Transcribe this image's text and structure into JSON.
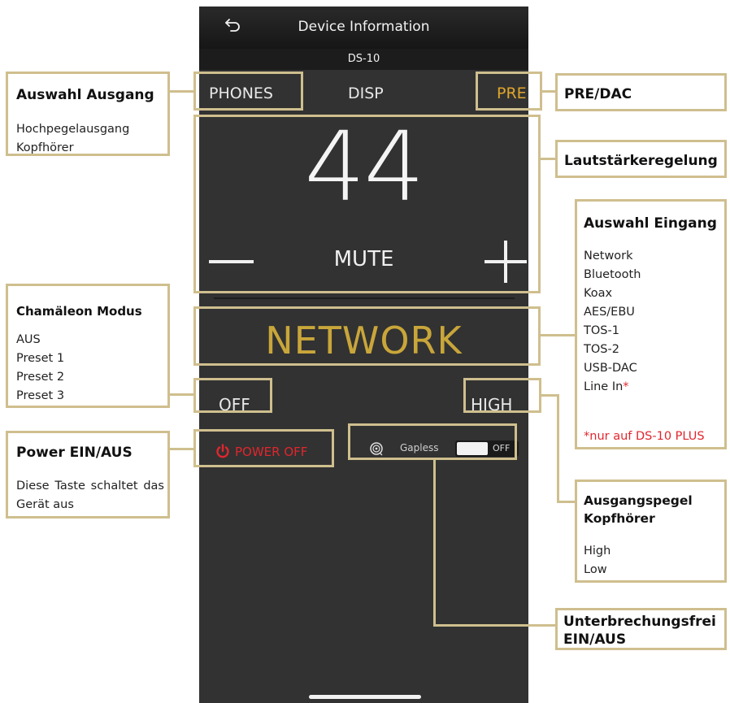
{
  "app": {
    "title": "Device Information",
    "model": "DS-10",
    "back_icon": "back-arrow-icon"
  },
  "output_tabs": [
    "PHONES",
    "DISP",
    "PRE"
  ],
  "volume": {
    "value": "44",
    "mute_label": "MUTE",
    "minus_icon": "minus-icon",
    "plus_icon": "plus-icon"
  },
  "input": {
    "current": "NETWORK"
  },
  "chameleon_mode": {
    "value": "OFF"
  },
  "headphone_level": {
    "value": "HIGH"
  },
  "power": {
    "label": "POWER OFF",
    "icon": "power-icon",
    "color": "#e0262d"
  },
  "gapless": {
    "label": "Gapless",
    "switch_state": "OFF",
    "icon": "disc-icon"
  },
  "callouts": {
    "output_select": {
      "title": "Auswahl Ausgang",
      "lines": [
        "Hochpegelausgang",
        "Kopfhörer"
      ]
    },
    "pre_dac": {
      "title": "PRE/DAC"
    },
    "volume_control": {
      "title": "Lautstärkeregelung"
    },
    "input_select": {
      "title": "Auswahl Eingang",
      "lines": [
        "Network",
        "Bluetooth",
        "Koax",
        "AES/EBU",
        "TOS-1",
        "TOS-2",
        "USB-DAC",
        "Line In"
      ],
      "asterisk": "*",
      "note": "*nur auf DS-10 PLUS"
    },
    "chameleon": {
      "title": "Chamäleon Modus",
      "lines": [
        "AUS",
        "Preset 1",
        "Preset 2",
        "Preset 3"
      ]
    },
    "power": {
      "title": "Power EIN/AUS",
      "text": "Diese Taste schaltet das Gerät aus"
    },
    "headphone_level": {
      "title_line1": "Ausgangspegel",
      "title_line2": "Kopfhörer",
      "lines": [
        "High",
        "Low"
      ]
    },
    "gapless": {
      "title_line1": "Unterbrechungsfrei",
      "title_line2": "EIN/AUS"
    }
  },
  "colors": {
    "accent_gold": "#c9a63a",
    "frame_gold": "#cfbf8e",
    "pre_active": "#e0a52a",
    "phone_bg": "#323232"
  }
}
